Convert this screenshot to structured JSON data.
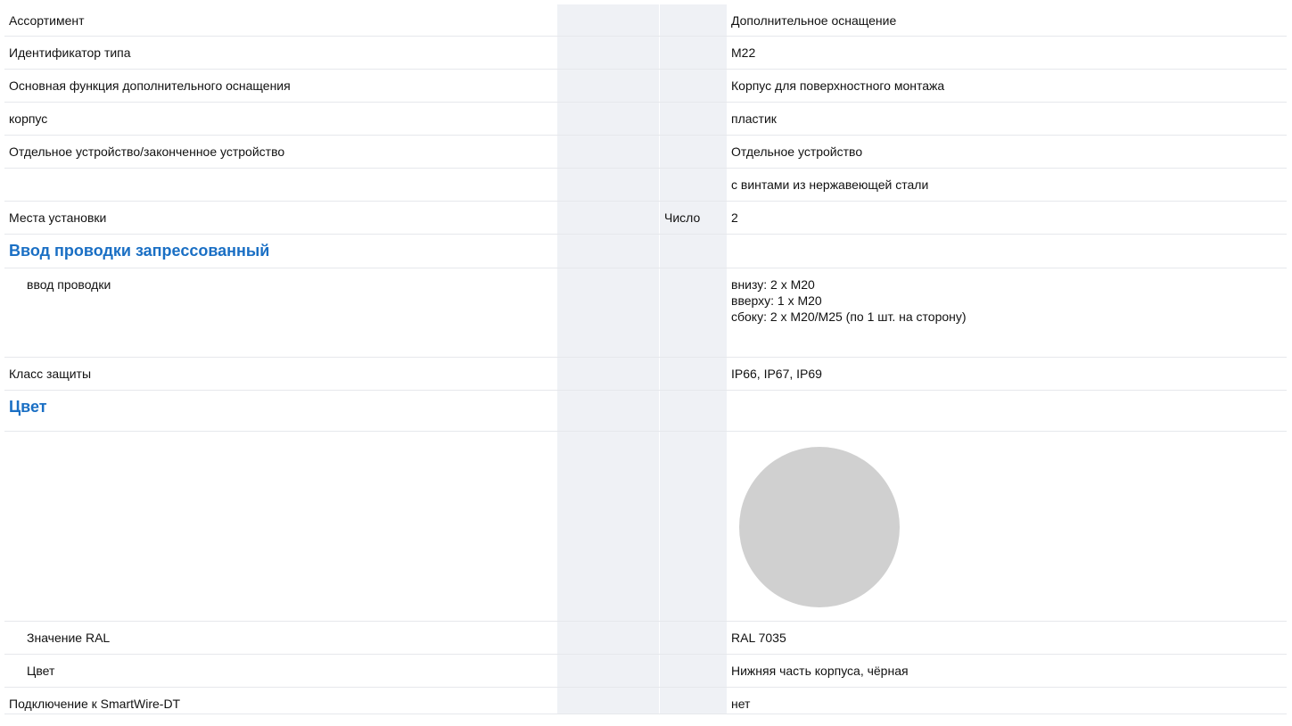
{
  "colors": {
    "section_heading": "#1a6fc4",
    "column_shade": "#eff1f5",
    "row_divider": "#e6e8ec",
    "ral_swatch": "#d0d0d0"
  },
  "rows": [
    {
      "label": "Ассортимент",
      "unit": "",
      "value": "Дополнительное оснащение"
    },
    {
      "label": "Идентификатор типа",
      "unit": "",
      "value": "M22"
    },
    {
      "label": "Основная функция дополнительного оснащения",
      "unit": "",
      "value": "Корпус для поверхностного монтажа"
    },
    {
      "label": "корпус",
      "unit": "",
      "value": "пластик"
    },
    {
      "label": "Отдельное устройство/законченное устройство",
      "unit": "",
      "value": "Отдельное устройство"
    },
    {
      "label": "",
      "unit": "",
      "value": "с винтами из нержавеющей стали"
    },
    {
      "label": "Места установки",
      "unit": "Число",
      "value": "2"
    },
    {
      "section": "Ввод проводки запрессованный"
    },
    {
      "label": "ввод проводки",
      "unit": "",
      "value_lines": [
        "внизу: 2 x M20",
        "вверху: 1 x M20",
        "сбоку: 2 x M20/M25 (по 1 шт. на сторону)"
      ]
    },
    {
      "label": "Класс защиты",
      "unit": "",
      "value": "IP66, IP67, IP69"
    },
    {
      "section": "Цвет"
    },
    {
      "label": "Значение RAL",
      "unit": "",
      "value": "RAL 7035"
    },
    {
      "label": "Цвет",
      "unit": "",
      "value": "Нижняя часть корпуса, чёрная"
    },
    {
      "label": "Подключение к SmartWire-DT",
      "unit": "",
      "value": "нет"
    }
  ]
}
